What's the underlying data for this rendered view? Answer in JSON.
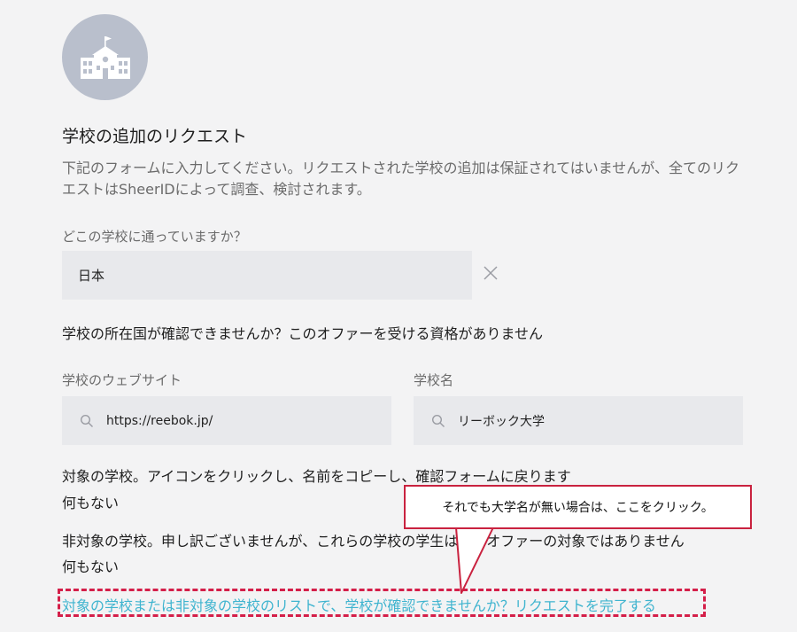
{
  "form": {
    "icon": "school-building-icon",
    "title": "学校の追加のリクエスト",
    "description": "下記のフォームに入力してください。リクエストされた学校の追加は保証されてはいませんが、全てのリクエストはSheerIDによって調查、検討されます。",
    "question_label": "どこの学校に通っていますか？",
    "country_value": "日本",
    "country_note": "学校の所在国が確認できませんか？このオファーを受ける資格がありません",
    "website_label": "学校のウェブサイト",
    "website_value": "https://reebok.jp/",
    "school_name_label": "学校名",
    "school_name_value": "リーボック大学"
  },
  "results": {
    "eligible_heading": "対象の学校。アイコンをクリックし、名前をコピーし、確認フォームに戻ります",
    "eligible_empty": "何もない",
    "ineligible_heading": "非対象の学校。申し訳ございませんが、これらの学校の学生はこのオファーの対象ではありません",
    "ineligible_empty": "何もない",
    "request_link": "対象の学校または非対象の学校のリストで、学校が確認できませんか？リクエストを完了する"
  },
  "annotation": {
    "callout_text": "それでも大学名が無い場合は、ここをクリック。",
    "accent_color": "#d41f49"
  },
  "colors": {
    "link": "#3fb4cf",
    "field_bg": "#e8e9ec",
    "avatar_bg": "#b9bfcc",
    "page_bg": "#f3f3f4"
  }
}
